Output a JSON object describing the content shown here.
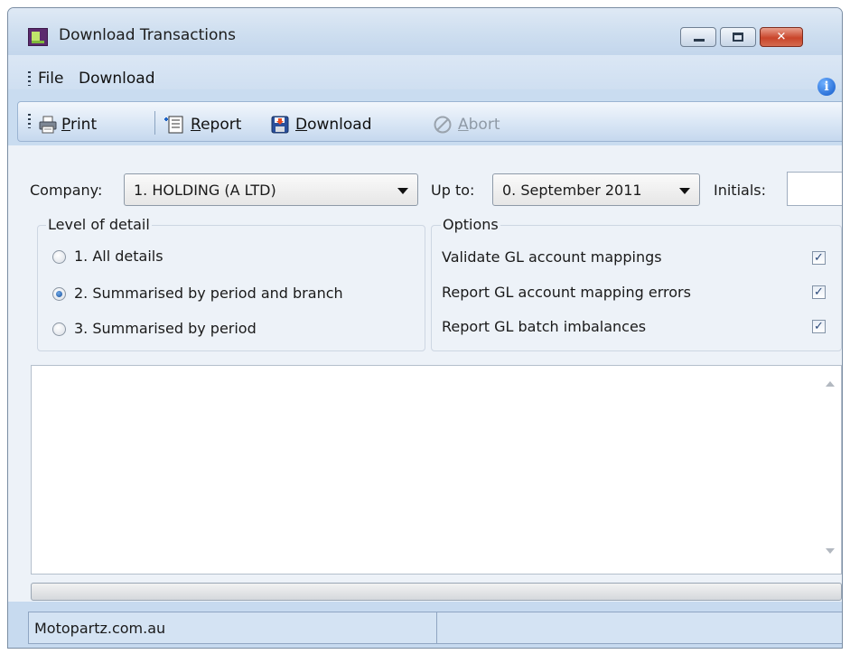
{
  "window": {
    "title": "Download Transactions"
  },
  "menubar": {
    "items": [
      "File",
      "Download"
    ]
  },
  "toolbar": {
    "print": {
      "accel": "P",
      "rest": "rint"
    },
    "report": {
      "accel": "R",
      "rest": "eport"
    },
    "download": {
      "accel": "D",
      "rest": "ownload"
    },
    "abort": {
      "accel": "A",
      "rest": "bort",
      "enabled": false
    }
  },
  "form": {
    "company_label": "Company:",
    "company_value": "1. HOLDING (A LTD)",
    "upto_label": "Up to:",
    "upto_value": "0. September 2011",
    "initials_label": "Initials:",
    "initials_value": ""
  },
  "level_of_detail": {
    "title": "Level of detail",
    "options": [
      {
        "label": "1. All details",
        "selected": false
      },
      {
        "label": "2. Summarised by period and branch",
        "selected": true
      },
      {
        "label": "3. Summarised by period",
        "selected": false
      }
    ]
  },
  "options": {
    "title": "Options",
    "items": [
      {
        "label": "Validate GL account mappings",
        "checked": true
      },
      {
        "label": "Report GL account mapping errors",
        "checked": true
      },
      {
        "label": "Report GL batch imbalances",
        "checked": true
      }
    ]
  },
  "output": {
    "text": ""
  },
  "progress": {
    "value": 0
  },
  "statusbar": {
    "text": "Motopartz.com.au"
  },
  "icons": {
    "app": "app-icon",
    "info": "info-icon",
    "print": "printer-icon",
    "report": "report-icon",
    "download": "download-icon",
    "abort": "abort-icon"
  }
}
